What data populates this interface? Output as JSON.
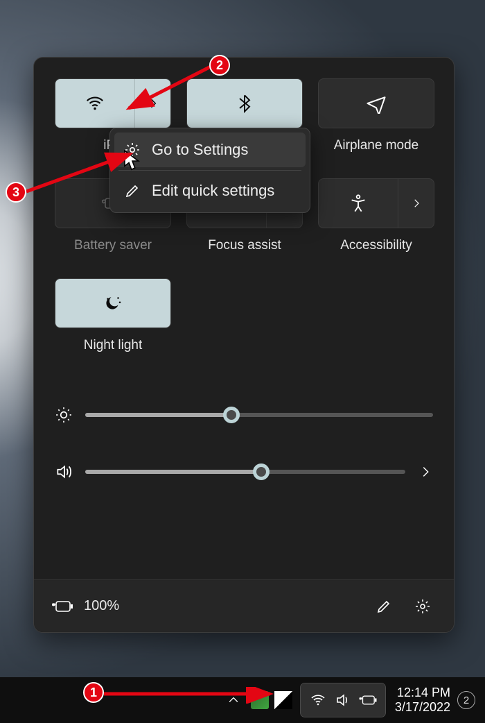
{
  "tiles": {
    "wifi": {
      "label": "iPh"
    },
    "bluetooth": {
      "label": ""
    },
    "airplane": {
      "label": "Airplane mode"
    },
    "battery": {
      "label": "Battery saver"
    },
    "focus": {
      "label": "Focus assist"
    },
    "access": {
      "label": "Accessibility"
    },
    "nightlight": {
      "label": "Night light"
    }
  },
  "context_menu": {
    "go_to_settings": "Go to Settings",
    "edit_quick": "Edit quick settings"
  },
  "sliders": {
    "brightness_pct": 42,
    "volume_pct": 55
  },
  "panel_footer": {
    "battery_text": "100%"
  },
  "taskbar": {
    "time": "12:14 PM",
    "date": "3/17/2022",
    "notif_count": "2"
  },
  "annotations": {
    "1": "1",
    "2": "2",
    "3": "3"
  }
}
